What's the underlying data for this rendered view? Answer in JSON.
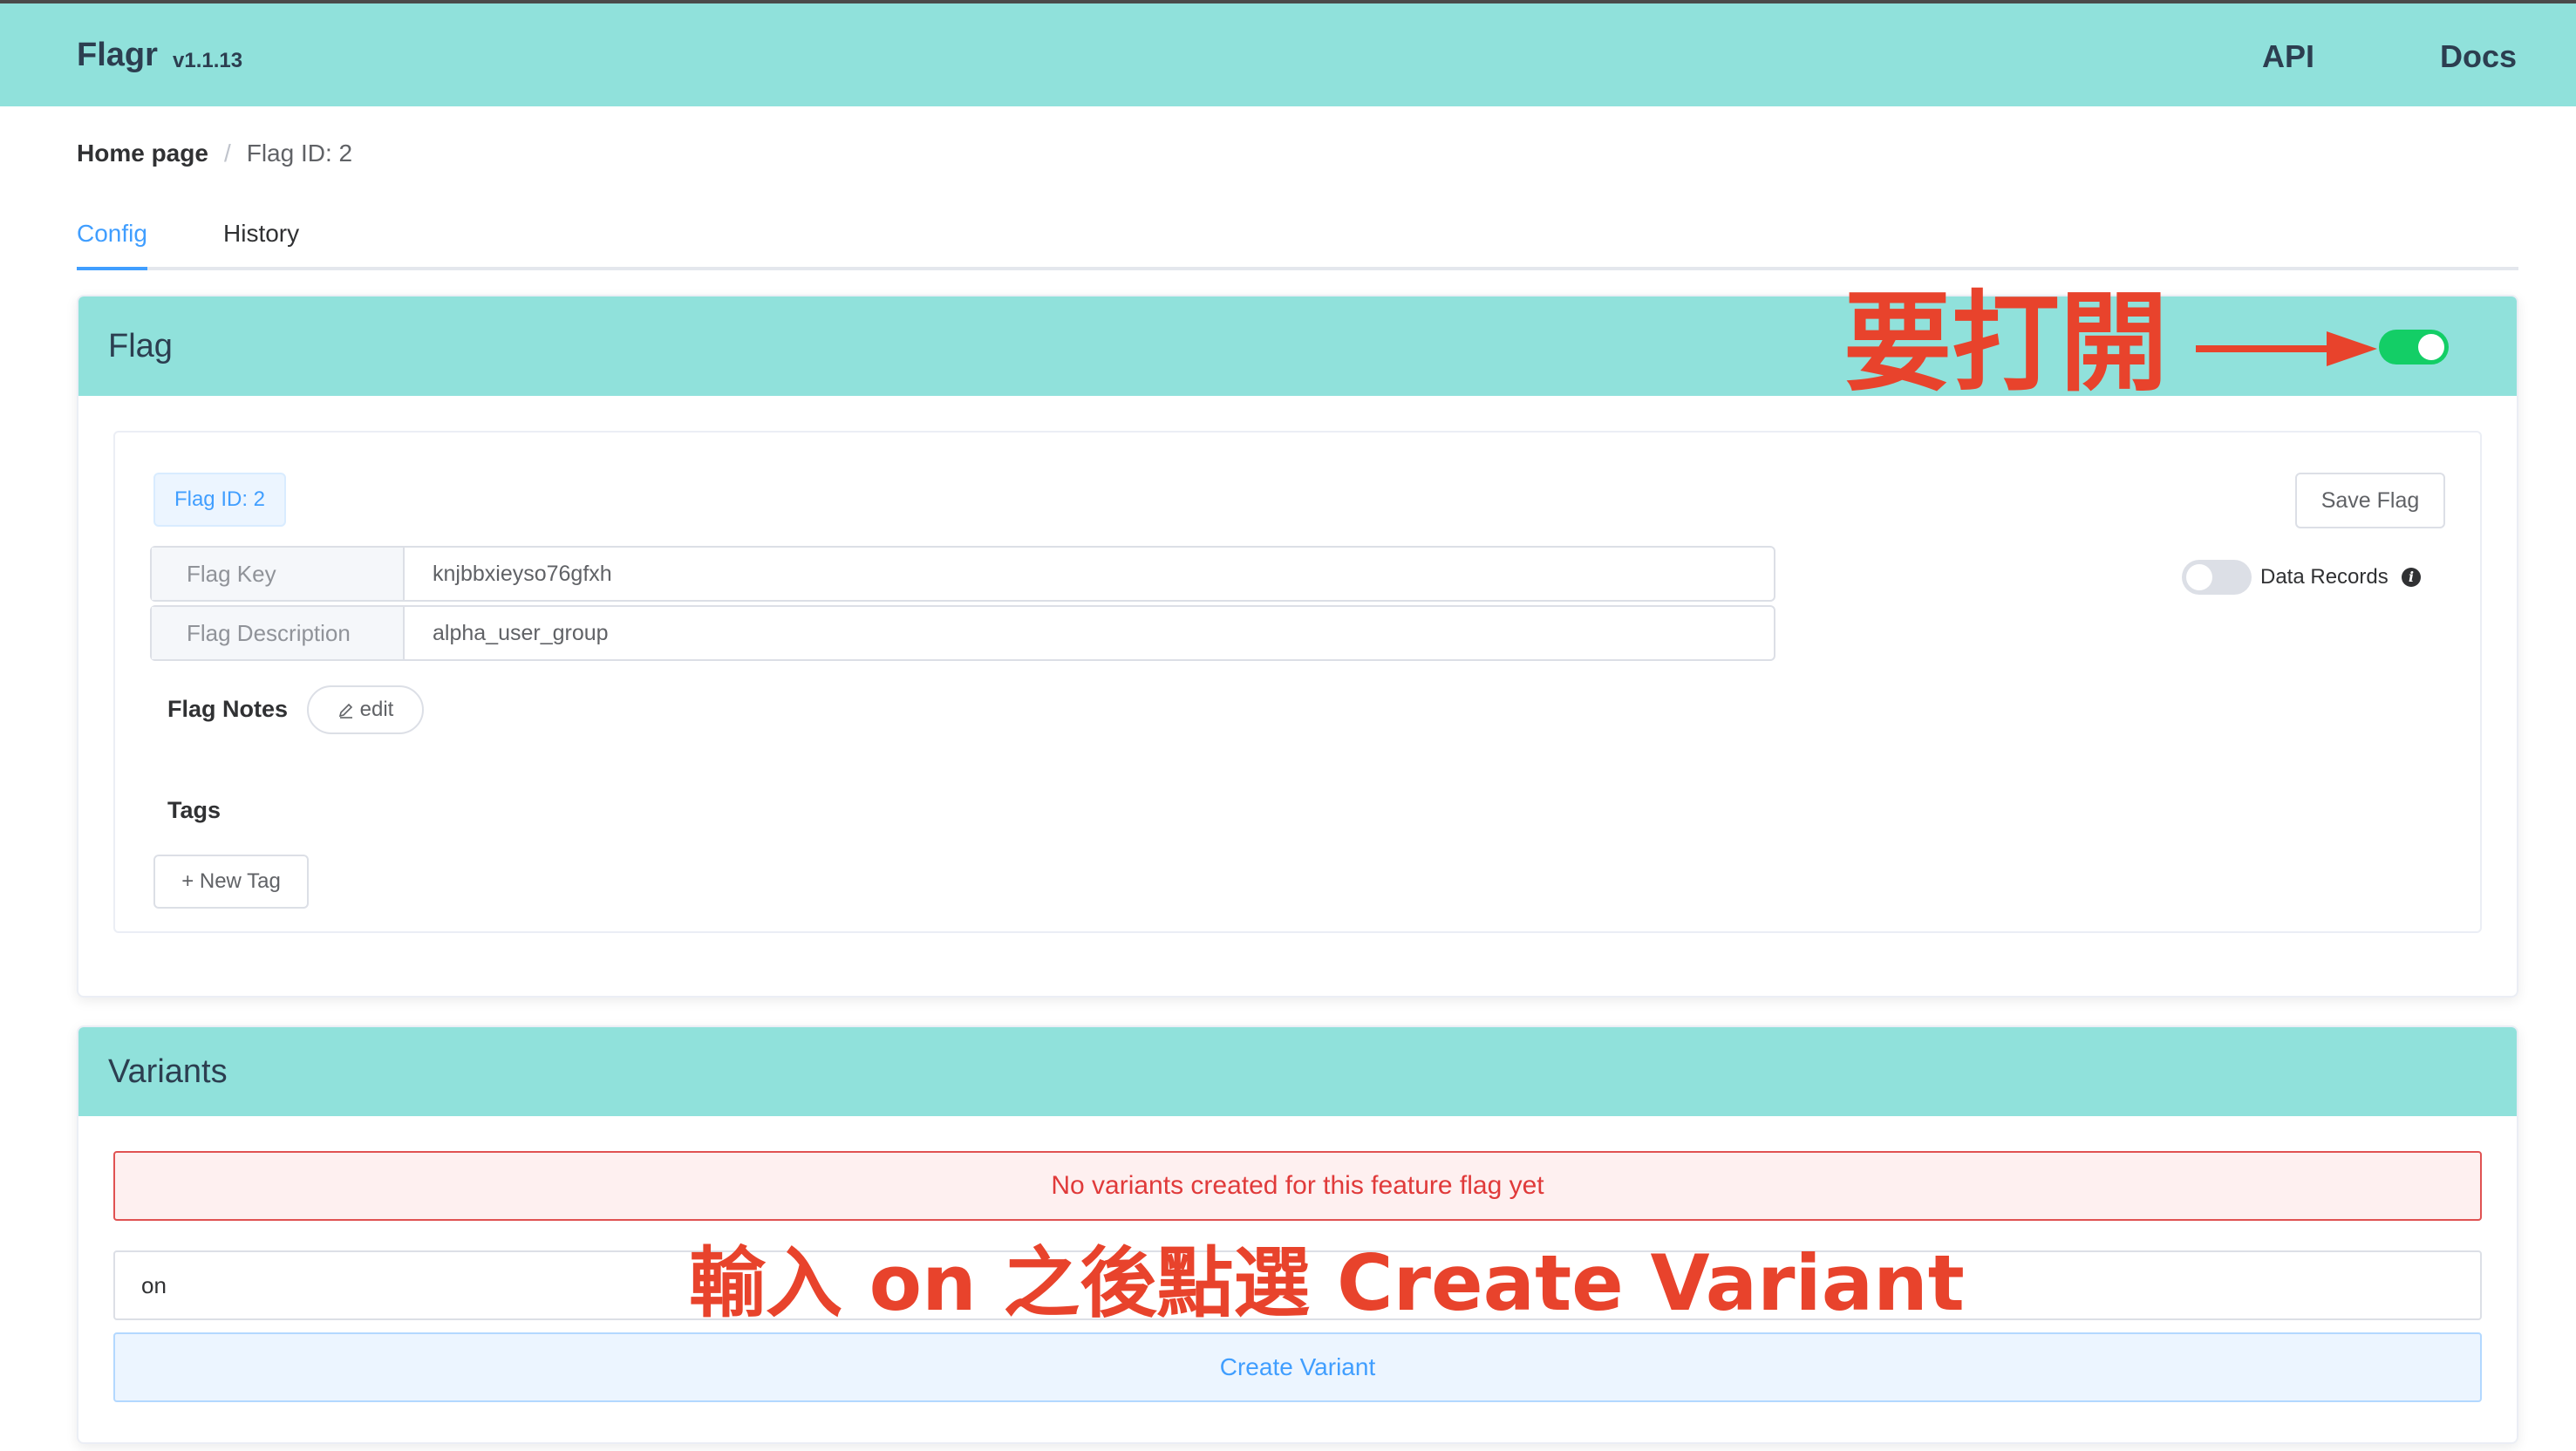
{
  "app": {
    "brand": "Flagr",
    "version": "v1.1.13",
    "nav": {
      "api": "API",
      "docs": "Docs"
    }
  },
  "breadcrumb": {
    "home": "Home page",
    "separator": "/",
    "current": "Flag ID: 2"
  },
  "tabs": [
    {
      "label": "Config",
      "active": true
    },
    {
      "label": "History",
      "active": false
    }
  ],
  "flag_card": {
    "title": "Flag",
    "enabled": true,
    "flag_id_tag": "Flag ID: 2",
    "save_label": "Save Flag",
    "data_records": {
      "label": "Data Records",
      "enabled": false,
      "info_icon": "i"
    },
    "fields": [
      {
        "label": "Flag Key",
        "value": "knjbbxieyso76gfxh"
      },
      {
        "label": "Flag Description",
        "value": "alpha_user_group"
      }
    ],
    "notes_label": "Flag Notes",
    "edit_label": "edit",
    "tags_label": "Tags",
    "new_tag_label": "+ New Tag"
  },
  "variants_card": {
    "title": "Variants",
    "empty_message": "No variants created for this feature flag yet",
    "input_value": "on",
    "create_label": "Create Variant"
  },
  "annotations": {
    "toggle_hint": "要打開",
    "variant_hint": "輸入 on 之後點選 Create Variant",
    "color": "#e8432c"
  },
  "colors": {
    "header": "#90e1db",
    "accent": "#409eff",
    "toggle_on": "#13ce66",
    "toggle_off": "#dcdfe6",
    "error": "#e03a3a"
  }
}
